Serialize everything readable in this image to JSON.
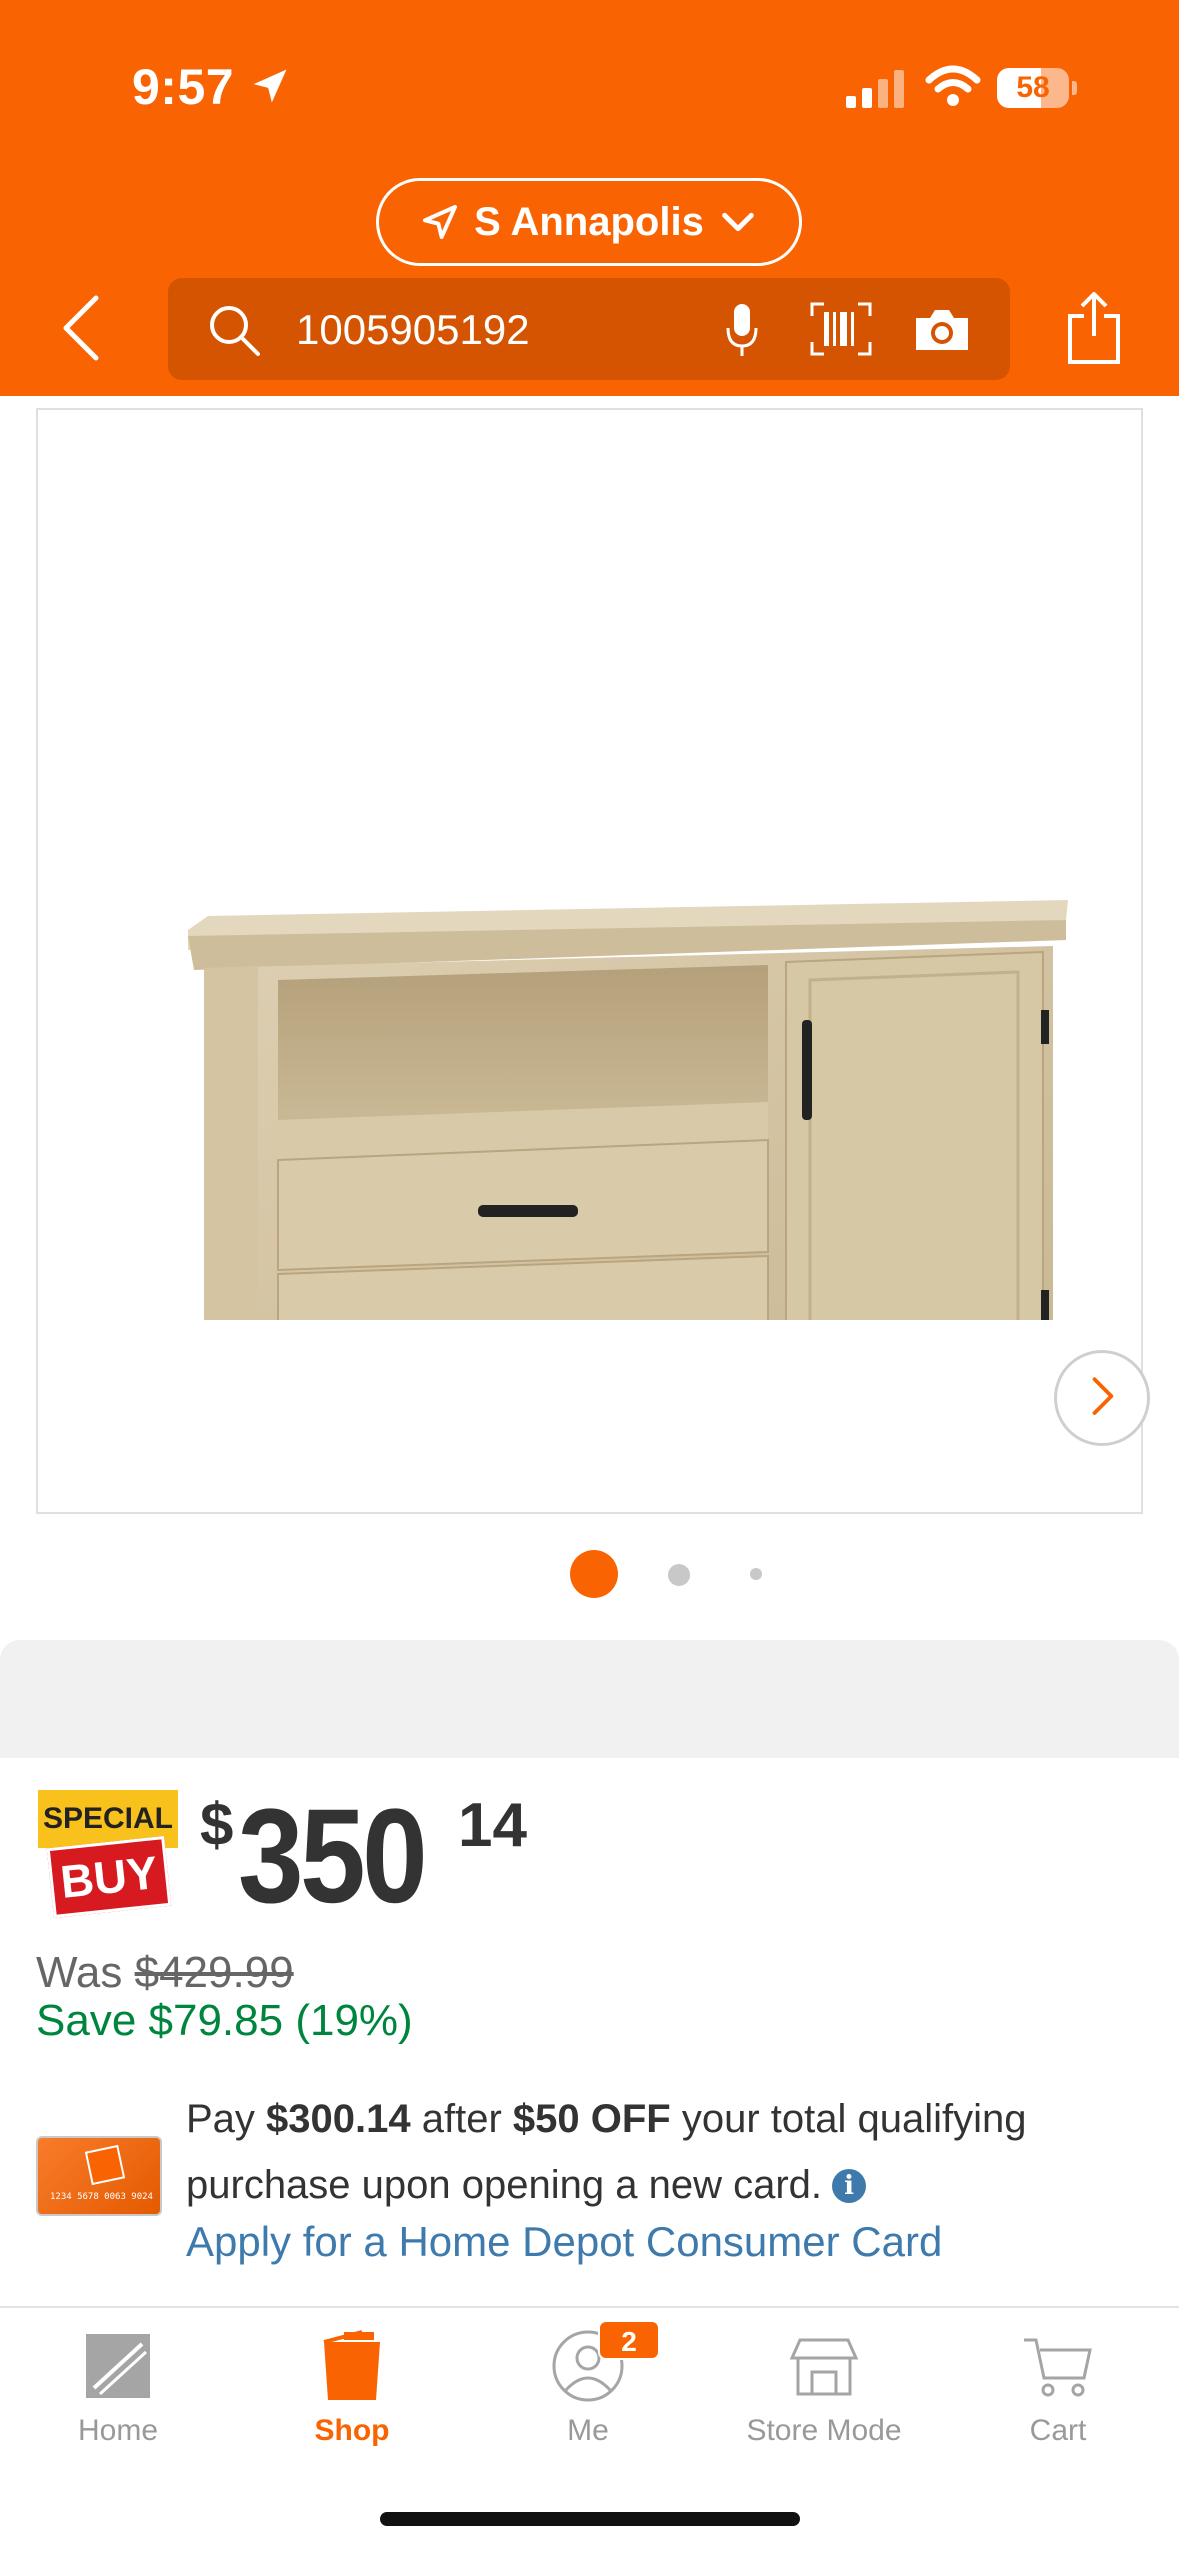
{
  "status_bar": {
    "time": "9:57",
    "battery": "58"
  },
  "header": {
    "location": "S Annapolis",
    "search_query": "1005905192"
  },
  "gallery": {
    "image_count": 3,
    "active_index": 0
  },
  "pricing": {
    "badge_top": "SPECIAL",
    "badge_bottom": "BUY",
    "currency": "$",
    "dollars": "350",
    "cents": "14",
    "was_label": "Was",
    "was_price": "$429.99",
    "save_text": "Save $79.85 (19%)"
  },
  "card_offer": {
    "text_1": "Pay ",
    "amount_after": "$300.14",
    "text_2": " after ",
    "discount": "$50 OFF",
    "text_3": " your total qualifying purchase upon opening a new card.",
    "info_glyph": "i",
    "card_number": "1234 5678 0063 9024",
    "apply_link": "Apply for a Home Depot Consumer Card"
  },
  "tabbar": {
    "items": [
      {
        "label": "Home",
        "icon": "home-depot-logo-icon"
      },
      {
        "label": "Shop",
        "icon": "bucket-icon"
      },
      {
        "label": "Me",
        "icon": "person-icon",
        "badge": "2"
      },
      {
        "label": "Store Mode",
        "icon": "store-icon"
      },
      {
        "label": "Cart",
        "icon": "cart-icon"
      }
    ],
    "active": "Shop"
  },
  "colors": {
    "brand_orange": "#f96302",
    "save_green": "#00853e",
    "link_blue": "#3e7aab",
    "special_yellow": "#f8c11b",
    "special_red": "#d71920"
  }
}
